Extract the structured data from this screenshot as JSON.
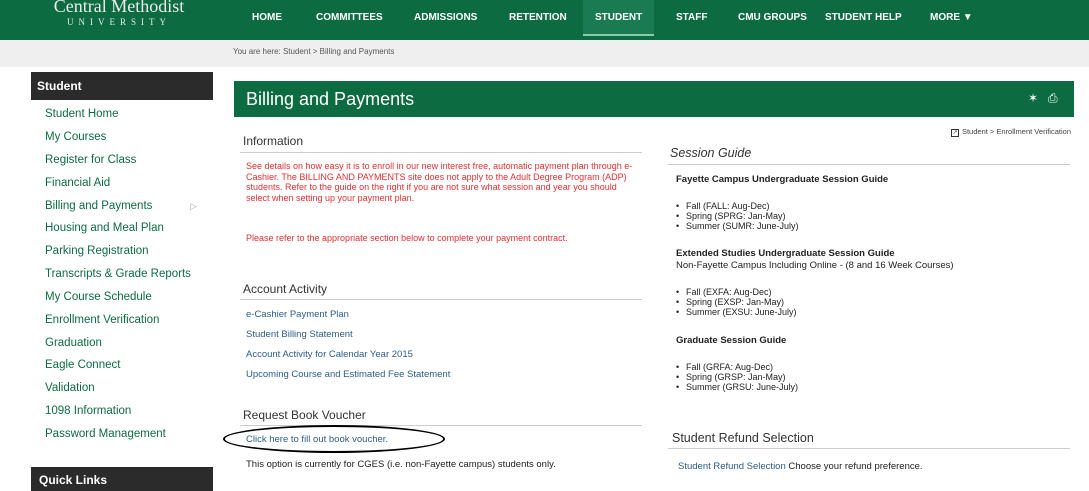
{
  "logo": {
    "line1": "Central Methodist",
    "line2": "UNIVERSITY"
  },
  "nav": [
    "HOME",
    "COMMITTEES",
    "ADMISSIONS",
    "RETENTION",
    "STUDENT",
    "STAFF",
    "CMU GROUPS",
    "STUDENT HELP",
    "MORE ▼"
  ],
  "breadcrumb": "You are here:  Student > Billing and Payments",
  "sidebar": {
    "heading": "Student",
    "items": [
      "Student Home",
      "My Courses",
      "Register for Class",
      "Financial Aid",
      "Billing and Payments",
      "Housing and Meal Plan",
      "Parking Registration",
      "Transcripts & Grade Reports",
      "My Course Schedule",
      "Enrollment Verification",
      "Graduation",
      "Eagle Connect",
      "Validation",
      "1098 Information",
      "Password Management"
    ],
    "active_indicator": "▷",
    "quick_links": "Quick Links"
  },
  "page": {
    "title": "Billing and Payments",
    "icons": {
      "gear": "✶",
      "print": "⎙"
    }
  },
  "information": {
    "heading": "Information",
    "para1": "See details on how easy it is to enroll in our new interest free, automatic payment plan through e-Cashier.   The BILLING AND PAYMENTS site does not apply to the Adult Degree Program (ADP) students.  Refer to the guide on the right if you are not sure what session and year you should select when setting up your payment plan.",
    "para2": "Please refer to the appropriate section below to complete your payment contract."
  },
  "account_activity": {
    "heading": "Account Activity",
    "links": [
      "e-Cashier Payment Plan",
      "Student Billing Statement",
      "Account Activity for Calendar Year 2015",
      "Upcoming Course and Estimated Fee Statement"
    ]
  },
  "book_voucher": {
    "heading": "Request Book Voucher",
    "link": "Click here to fill out book voucher.",
    "note": "This option is currently for CGES (i.e. non-Fayette campus) students only."
  },
  "related_link": {
    "icon": "↗",
    "text": "Student > Enrollment Verification"
  },
  "session_guide": {
    "heading": "Session Guide",
    "fayette": {
      "title": "Fayette Campus Undergraduate Session Guide",
      "items": [
        "Fall (FALL: Aug-Dec)",
        "Spring (SPRG: Jan-May)",
        "Summer (SUMR: June-July)"
      ]
    },
    "extended": {
      "title": "Extended Studies Undergraduate Session Guide",
      "subtitle": "Non-Fayette Campus Including Online - (8 and 16 Week Courses)",
      "items": [
        "Fall (EXFA: Aug-Dec)",
        "Spring (EXSP: Jan-May)",
        "Summer (EXSU: June-July)"
      ]
    },
    "graduate": {
      "title": "Graduate Session Guide",
      "items": [
        "Fall (GRFA: Aug-Dec)",
        "Spring (GRSP: Jan-May)",
        "Summer (GRSU: June-July)"
      ]
    }
  },
  "refund": {
    "heading": "Student Refund Selection",
    "link": "Student Refund Selection",
    "note": "Choose your refund preference."
  },
  "colors": {
    "brand_green": "#0d6b42",
    "alert_red": "#e3302f",
    "link_blue": "#2b5c8a"
  }
}
